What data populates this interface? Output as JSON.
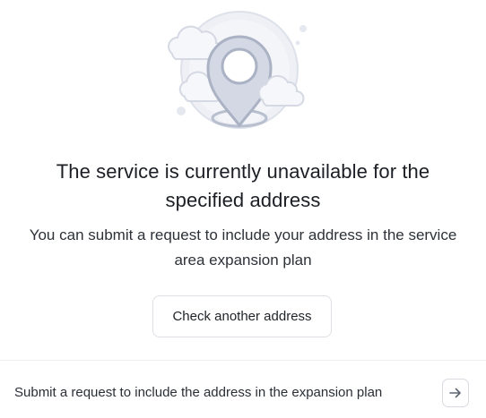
{
  "illustration": {
    "icon": "map-pin-with-clouds"
  },
  "message": {
    "title": "The service is currently unavailable for the specified address",
    "subtitle": "You can submit a request to include your address in the service area expansion plan"
  },
  "actions": {
    "check_address_label": "Check another address",
    "submit_request_label": "Submit a request to include the address in the expansion plan",
    "submit_request_icon": "arrow-right-icon"
  },
  "colors": {
    "text_primary": "#1b1e24",
    "border": "#dcdfe4",
    "illustration_fill": "#e3e7f0",
    "illustration_stroke": "#aeb5c6"
  }
}
